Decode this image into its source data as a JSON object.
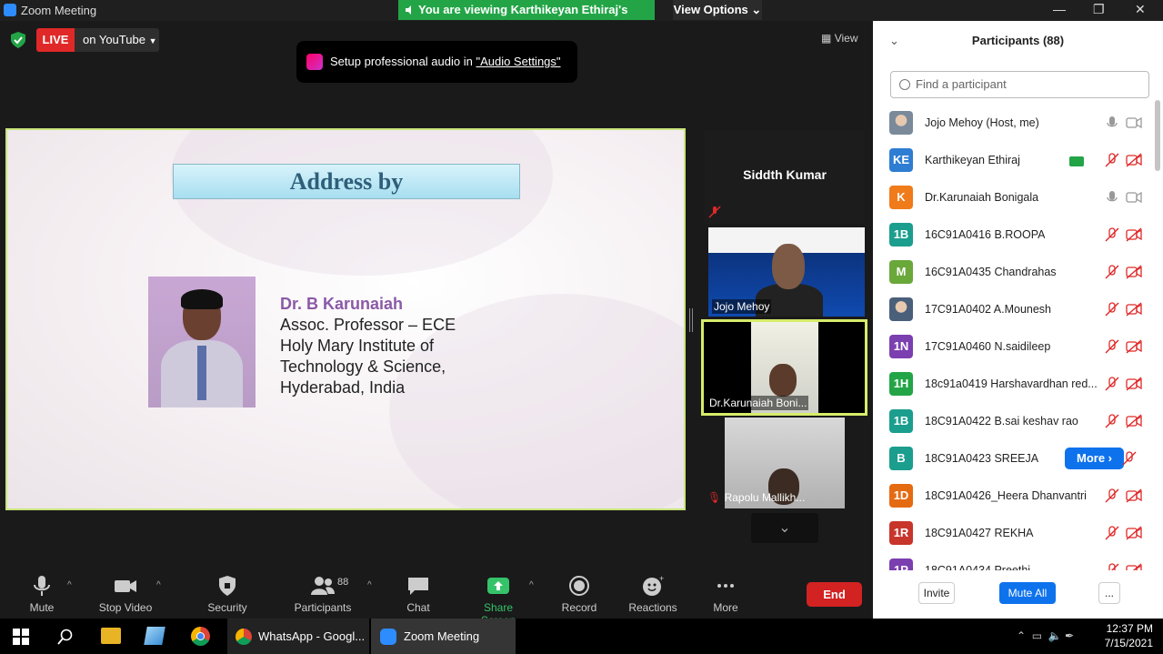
{
  "window": {
    "title": "Zoom Meeting"
  },
  "banner": {
    "viewing_text": "You are viewing Karthikeyan Ethiraj's screen",
    "view_options": "View Options"
  },
  "live": {
    "badge": "LIVE",
    "platform": "on YouTube"
  },
  "audio_tip": {
    "prefix": "Setup professional audio in ",
    "link": "\"Audio Settings\""
  },
  "view_button": "View",
  "slide": {
    "heading": "Address by",
    "speaker_name": "Dr. B Karunaiah",
    "lines": [
      "Assoc. Professor – ECE",
      "Holy Mary Institute of",
      "Technology & Science,",
      "Hyderabad, India"
    ]
  },
  "video_tiles": [
    {
      "name": "Siddth Kumar"
    },
    {
      "name": "Jojo Mehoy"
    },
    {
      "name": "Dr.Karunaiah Boni..."
    },
    {
      "name": "Rapolu Mallikh..."
    }
  ],
  "toolbar": {
    "mute": "Mute",
    "stop_video": "Stop Video",
    "security": "Security",
    "participants": "Participants",
    "participants_count": "88",
    "chat": "Chat",
    "share_screen": "Share Screen",
    "record": "Record",
    "reactions": "Reactions",
    "more": "More",
    "end": "End"
  },
  "participants_panel": {
    "title": "Participants (88)",
    "search_placeholder": "Find a participant",
    "items": [
      {
        "initials": "",
        "name": "Jojo Mehoy (Host, me)",
        "color": "#7a8a9a",
        "audio": "on"
      },
      {
        "initials": "KE",
        "name": "Karthikeyan Ethiraj",
        "color": "#2d7dd2",
        "audio": "muted",
        "sharing": true
      },
      {
        "initials": "K",
        "name": "Dr.Karunaiah Bonigala",
        "color": "#f07b1a",
        "audio": "on"
      },
      {
        "initials": "1B",
        "name": "16C91A0416 B.ROOPA",
        "color": "#1b9e8e",
        "audio": "muted"
      },
      {
        "initials": "M",
        "name": "16C91A0435 Chandrahas",
        "color": "#6aa83a",
        "audio": "muted"
      },
      {
        "initials": "",
        "name": "17C91A0402 A.Mounesh",
        "color": "#4a5f7a",
        "audio": "muted"
      },
      {
        "initials": "1N",
        "name": "17C91A0460 N.saidileep",
        "color": "#7b3fb0",
        "audio": "muted"
      },
      {
        "initials": "1H",
        "name": "18c91a0419 Harshavardhan red...",
        "color": "#23a547",
        "audio": "muted"
      },
      {
        "initials": "1B",
        "name": "18C91A0422 B.sai keshav rao",
        "color": "#1b9e8e",
        "audio": "muted"
      },
      {
        "initials": "B",
        "name": "18C91A0423 SREEJA",
        "color": "#1b9e8e",
        "audio": "muted",
        "more": "More"
      },
      {
        "initials": "1D",
        "name": "18C91A0426_Heera Dhanvantri",
        "color": "#e56b12",
        "audio": "muted"
      },
      {
        "initials": "1R",
        "name": "18C91A0427  REKHA",
        "color": "#c8352b",
        "audio": "muted"
      },
      {
        "initials": "1P",
        "name": "18C91A0434 Preethi",
        "color": "#7b3fb0",
        "audio": "muted"
      }
    ],
    "footer": {
      "invite": "Invite",
      "mute_all": "Mute All",
      "more": "..."
    }
  },
  "taskbar": {
    "apps": [
      {
        "label": "WhatsApp - Googl..."
      },
      {
        "label": "Zoom Meeting"
      }
    ],
    "time": "12:37 PM",
    "date": "7/15/2021"
  }
}
